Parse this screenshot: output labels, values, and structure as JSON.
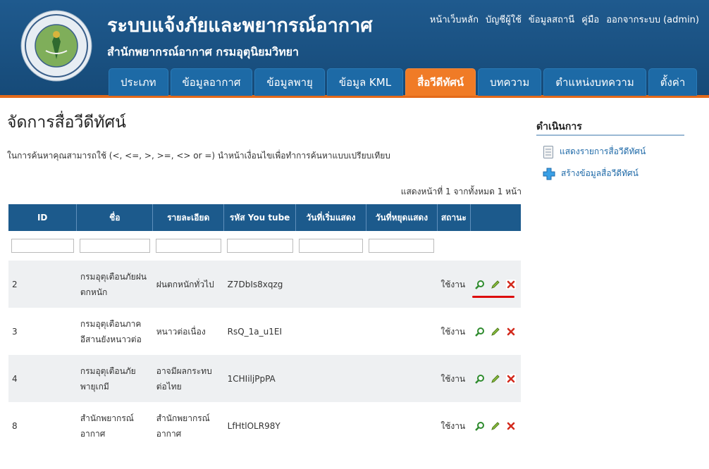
{
  "header": {
    "title": "ระบบแจ้งภัยและพยากรณ์อากาศ",
    "subtitle": "สำนักพยากรณ์อากาศ กรมอุตุนิยมวิทยา",
    "logo_text": "กรมอุตุนิยมวิทยา METEOROLOGICAL DEPARTMENT",
    "top_links": [
      "หน้าเว็บหลัก",
      "บัญชีผู้ใช้",
      "ข้อมูลสถานี",
      "คู่มือ",
      "ออกจากระบบ (admin)"
    ]
  },
  "nav": {
    "tabs": [
      "ประเภท",
      "ข้อมูลอากาศ",
      "ข้อมูลพายุ",
      "ข้อมูล KML",
      "สื่อวีดีทัศน์",
      "บทความ",
      "ตำแหน่งบทความ",
      "ตั้งค่า"
    ],
    "active_index": 4
  },
  "main": {
    "title": "จัดการสื่อวีดีทัศน์",
    "hint": "ในการค้นหาคุณสามารถใช้ (<, <=, >, >=, <> or =) นำหน้าเงื่อนไขเพื่อทำการค้นหาแบบเปรียบเทียบ",
    "summary": "แสดงหน้าที่ 1 จากทั้งหมด 1 หน้า"
  },
  "table": {
    "columns": [
      "ID",
      "ชื่อ",
      "รายละเอียด",
      "รหัส You tube",
      "วันที่เริ่มแสดง",
      "วันที่หยุดแสดง",
      "สถานะ"
    ],
    "rows": [
      {
        "id": "2",
        "name": "กรมอุตุเตือนภัยฝนตกหนัก",
        "detail": "ฝนตกหนักทั่วไป",
        "youtube": "Z7DbIs8xqzg",
        "start": "",
        "stop": "",
        "status": "ใช้งาน"
      },
      {
        "id": "3",
        "name": "กรมอุตุเตือนภาคอีสานยังหนาวต่อ",
        "detail": "หนาวต่อเนื่อง",
        "youtube": "RsQ_1a_u1EI",
        "start": "",
        "stop": "",
        "status": "ใช้งาน"
      },
      {
        "id": "4",
        "name": "กรมอุตุเตือนภัยพายุเกมี",
        "detail": "อาจมีผลกระทบต่อไทย",
        "youtube": "1CHIiljPpPA",
        "start": "",
        "stop": "",
        "status": "ใช้งาน"
      },
      {
        "id": "8",
        "name": "สำนักพยากรณ์อากาศ",
        "detail": "สำนักพยากรณ์อากาศ",
        "youtube": "LfHtlOLR98Y",
        "start": "",
        "stop": "",
        "status": "ใช้งาน"
      }
    ],
    "action_icons": [
      "view-icon",
      "edit-icon",
      "delete-icon"
    ]
  },
  "sidebar": {
    "title": "ดำเนินการ",
    "links": [
      "แสดงรายการสื่อวีดีทัศน์",
      "สร้างข้อมูลสื่อวีดีทัศน์"
    ]
  },
  "colors": {
    "header_bg": "#1a5585",
    "active_tab": "#f07b26",
    "table_header": "#1c5a8c",
    "link": "#1f6aa8",
    "highlight_underline": "#dd0d0d"
  }
}
